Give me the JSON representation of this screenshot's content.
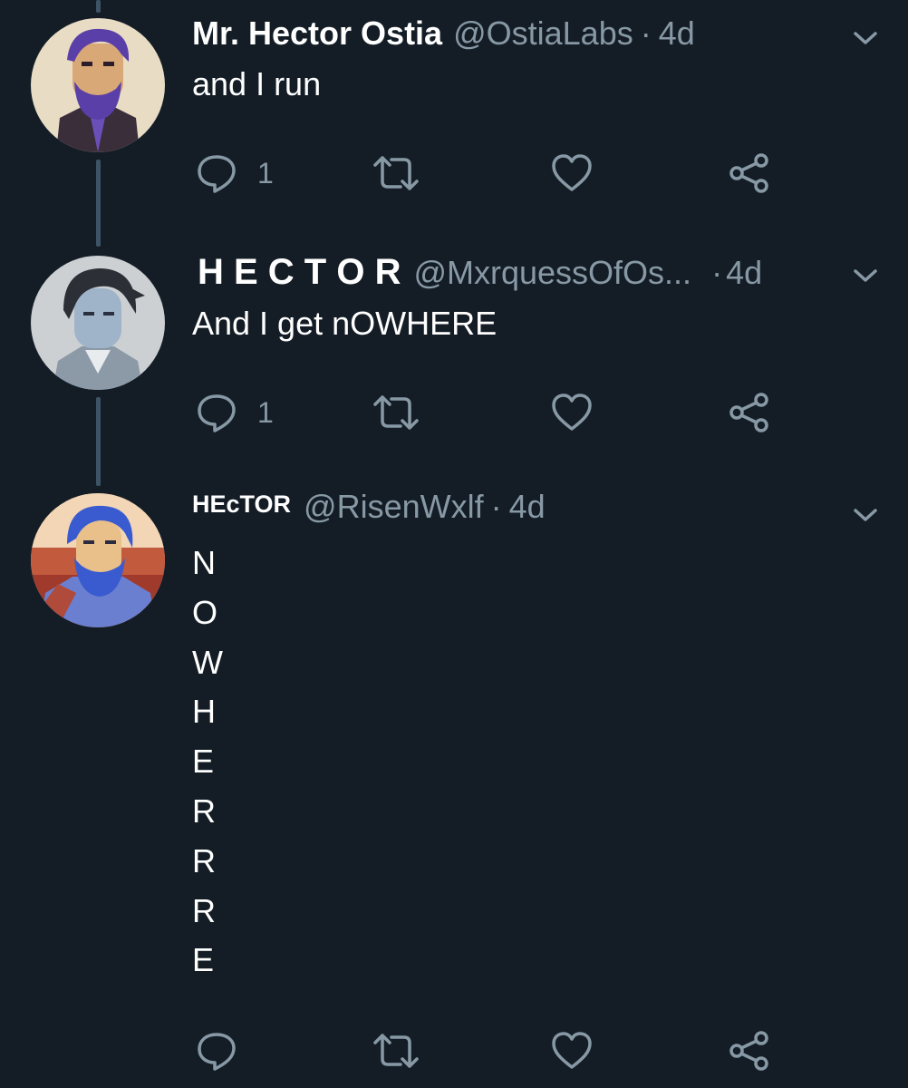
{
  "tweets": [
    {
      "name": "Mr. Hector Ostia",
      "handle": "@OstiaLabs",
      "separator": "·",
      "time": "4d",
      "text": "and I run",
      "reply_count": "1",
      "avatar_icon": "avatar-hector-ostia"
    },
    {
      "name": "H E C T O R",
      "handle": "@MxrquessOfOs...",
      "separator": "·",
      "time": "4d",
      "text": "And I get nOWHERE",
      "reply_count": "1",
      "avatar_icon": "avatar-hector-2"
    },
    {
      "name": "HEcTOR",
      "handle": "@RisenWxlf",
      "separator": "·",
      "time": "4d",
      "text_lines": [
        "N",
        "O",
        "W",
        "H",
        "E",
        "R",
        "R",
        "R",
        "E"
      ],
      "reply_count": "",
      "avatar_icon": "avatar-hector-3"
    }
  ],
  "icons": {
    "reply": "reply-icon",
    "retweet": "retweet-icon",
    "like": "heart-icon",
    "share": "share-icon",
    "more": "chevron-down-icon"
  },
  "colors": {
    "background": "#141d26",
    "secondary_text": "#8899a6",
    "thread_line": "#3d5466"
  }
}
